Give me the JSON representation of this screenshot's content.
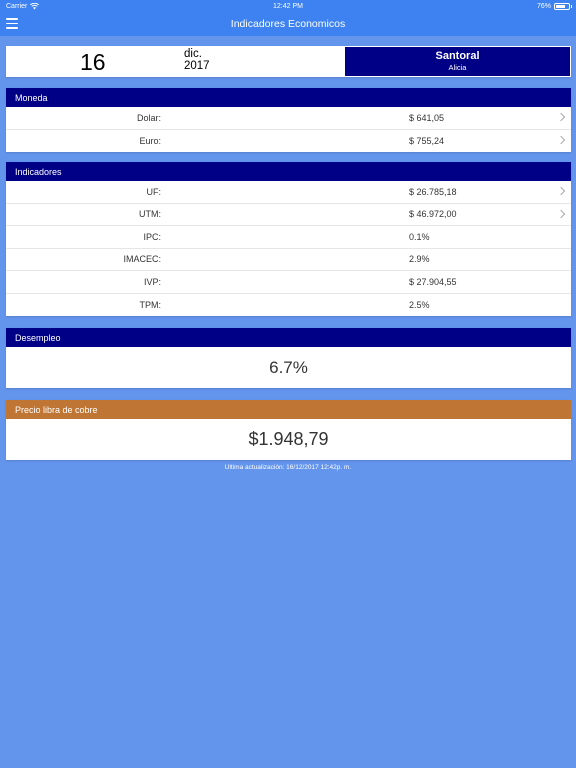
{
  "status_bar": {
    "carrier": "Carrier",
    "time": "12:42 PM",
    "battery_text": "76%",
    "battery_level": 0.76
  },
  "nav": {
    "title": "Indicadores Economicos"
  },
  "date": {
    "day": "16",
    "month": "dic.",
    "year": "2017"
  },
  "santoral": {
    "title": "Santoral",
    "name": "Alicia"
  },
  "moneda": {
    "header": "Moneda",
    "rows": [
      {
        "label": "Dolar:",
        "value": "$ 641,05"
      },
      {
        "label": "Euro:",
        "value": "$ 755,24"
      }
    ]
  },
  "indicadores": {
    "header": "Indicadores",
    "rows": [
      {
        "label": "UF:",
        "value": "$ 26.785,18"
      },
      {
        "label": "UTM:",
        "value": "$ 46.972,00"
      },
      {
        "label": "IPC:",
        "value": "0.1%"
      },
      {
        "label": "IMACEC:",
        "value": "2.9%"
      },
      {
        "label": "IVP:",
        "value": "$ 27.904,55"
      },
      {
        "label": "TPM:",
        "value": "2.5%"
      }
    ]
  },
  "desempleo": {
    "header": "Desempleo",
    "value": "6.7%"
  },
  "cobre": {
    "header": "Precio libra de cobre",
    "value": "$1.948,79"
  },
  "footer": {
    "last_update": "Ultima actualización: 16/12/2017 12:42p. m."
  },
  "colors": {
    "background": "#6495ed",
    "bar": "#3d82f0",
    "header_navy": "#000087",
    "header_copper": "#bf7533"
  },
  "icons": {
    "menu": "hamburger-menu-icon",
    "wifi": "wifi-icon",
    "battery": "battery-icon",
    "row_disclosure": "chevron-right-icon"
  }
}
